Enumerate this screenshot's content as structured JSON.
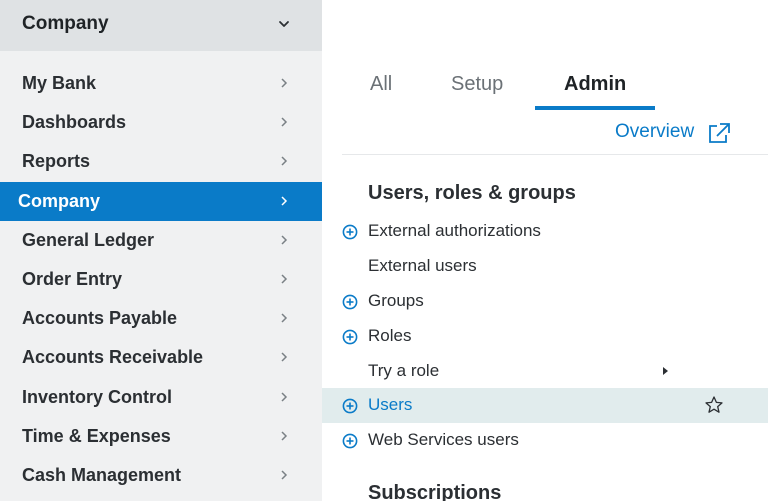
{
  "sidebar": {
    "header": "Company",
    "items": [
      {
        "label": "My Bank"
      },
      {
        "label": "Dashboards"
      },
      {
        "label": "Reports"
      },
      {
        "label": "Company"
      },
      {
        "label": "General Ledger"
      },
      {
        "label": "Order Entry"
      },
      {
        "label": "Accounts Payable"
      },
      {
        "label": "Accounts Receivable"
      },
      {
        "label": "Inventory Control"
      },
      {
        "label": "Time & Expenses"
      },
      {
        "label": "Cash Management"
      }
    ],
    "active_index": 3
  },
  "tabs": [
    {
      "label": "All"
    },
    {
      "label": "Setup"
    },
    {
      "label": "Admin"
    }
  ],
  "active_tab": "Admin",
  "overview": {
    "label": "Overview"
  },
  "sections": {
    "users": {
      "title": "Users, roles & groups",
      "items": [
        {
          "label": "External authorizations"
        },
        {
          "label": "External users"
        },
        {
          "label": "Groups"
        },
        {
          "label": "Roles"
        },
        {
          "label": "Try a role"
        },
        {
          "label": "Users"
        },
        {
          "label": "Web Services users"
        }
      ]
    },
    "subscriptions": {
      "title": "Subscriptions"
    }
  },
  "colors": {
    "accent": "#0a7bc8",
    "sidebar_bg": "#f0f1f2",
    "sidebar_header_bg": "#dfe2e4",
    "highlight_row": "#e1eced"
  },
  "icons": {
    "header_chevron": "chevron-down-icon",
    "nav_arrow": "chevron-right-icon",
    "add": "plus-circle-icon",
    "submenu": "caret-right-icon",
    "favorite": "star-icon",
    "external": "external-link-icon"
  }
}
